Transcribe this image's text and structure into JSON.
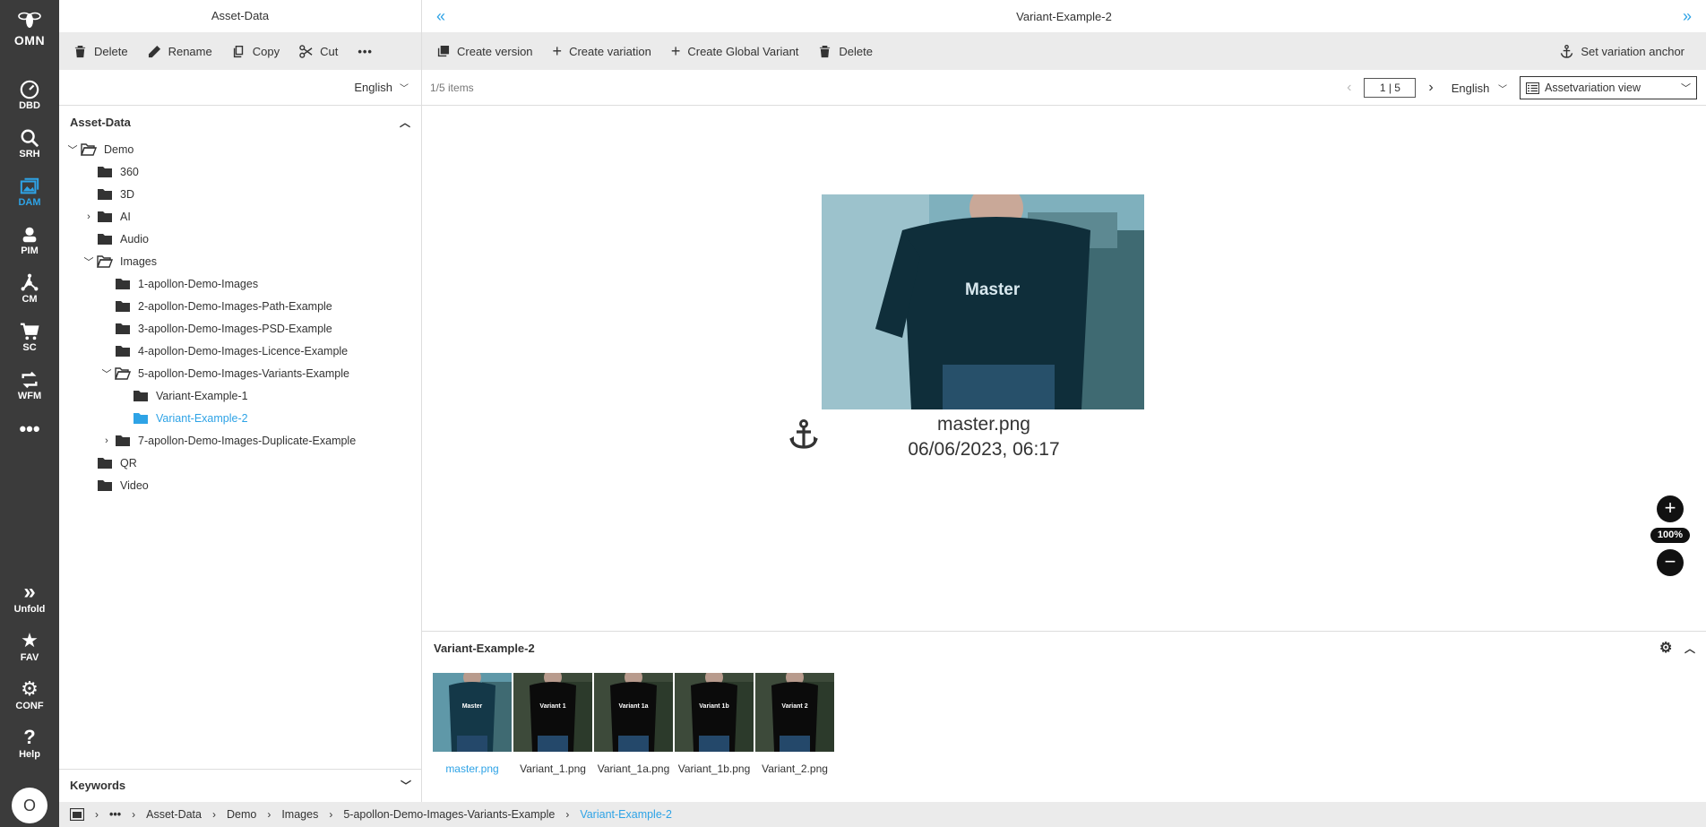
{
  "nav": {
    "logo_text": "OMN",
    "items": [
      {
        "label": "DBD",
        "icon": "dashboard-icon"
      },
      {
        "label": "SRH",
        "icon": "search-icon"
      },
      {
        "label": "DAM",
        "icon": "images-icon"
      },
      {
        "label": "PIM",
        "icon": "product-icon"
      },
      {
        "label": "CM",
        "icon": "network-icon"
      },
      {
        "label": "SC",
        "icon": "cart-icon"
      },
      {
        "label": "WFM",
        "icon": "workflow-icon"
      },
      {
        "label": "",
        "icon": "more-icon"
      }
    ],
    "bottom": [
      {
        "label": "Unfold",
        "icon": "unfold-icon"
      },
      {
        "label": "FAV",
        "icon": "star-icon"
      },
      {
        "label": "CONF",
        "icon": "gear-icon"
      },
      {
        "label": "Help",
        "icon": "help-icon"
      }
    ],
    "avatar": "O",
    "active_color": "#2ea3e6"
  },
  "left": {
    "title": "Asset-Data",
    "toolbar": {
      "delete": "Delete",
      "rename": "Rename",
      "copy": "Copy",
      "cut": "Cut"
    },
    "language": "English",
    "section": "Asset-Data",
    "tree": [
      {
        "label": "Demo",
        "level": 0,
        "expand": "open",
        "folder": "open"
      },
      {
        "label": "360",
        "level": 1,
        "expand": "none",
        "folder": "closed"
      },
      {
        "label": "3D",
        "level": 1,
        "expand": "none",
        "folder": "closed"
      },
      {
        "label": "AI",
        "level": 1,
        "expand": "closed",
        "folder": "closed"
      },
      {
        "label": "Audio",
        "level": 1,
        "expand": "none",
        "folder": "closed"
      },
      {
        "label": "Images",
        "level": 1,
        "expand": "open",
        "folder": "open"
      },
      {
        "label": "1-apollon-Demo-Images",
        "level": 2,
        "expand": "none",
        "folder": "closed"
      },
      {
        "label": "2-apollon-Demo-Images-Path-Example",
        "level": 2,
        "expand": "none",
        "folder": "closed"
      },
      {
        "label": "3-apollon-Demo-Images-PSD-Example",
        "level": 2,
        "expand": "none",
        "folder": "closed"
      },
      {
        "label": "4-apollon-Demo-Images-Licence-Example",
        "level": 2,
        "expand": "none",
        "folder": "closed"
      },
      {
        "label": "5-apollon-Demo-Images-Variants-Example",
        "level": 2,
        "expand": "open",
        "folder": "open"
      },
      {
        "label": "Variant-Example-1",
        "level": 3,
        "expand": "none",
        "folder": "closed"
      },
      {
        "label": "Variant-Example-2",
        "level": 3,
        "expand": "none",
        "folder": "closed",
        "active": true
      },
      {
        "label": "7-apollon-Demo-Images-Duplicate-Example",
        "level": 2,
        "expand": "closed",
        "folder": "closed"
      },
      {
        "label": "QR",
        "level": 1,
        "expand": "none",
        "folder": "closed"
      },
      {
        "label": "Video",
        "level": 1,
        "expand": "none",
        "folder": "closed"
      }
    ],
    "keywords": "Keywords"
  },
  "right": {
    "title": "Variant-Example-2",
    "toolbar": {
      "create_version": "Create version",
      "create_variation": "Create variation",
      "create_global_variant": "Create Global Variant",
      "delete": "Delete",
      "set_anchor": "Set variation anchor"
    },
    "count": "1/5 items",
    "page": "1 | 5",
    "language": "English",
    "view": "Assetvariation view",
    "preview": {
      "overlay_text": "Master",
      "filename": "master.png",
      "date": "06/06/2023, 06:17"
    },
    "zoom": "100%"
  },
  "variants": {
    "title": "Variant-Example-2",
    "items": [
      {
        "caption": "master.png",
        "label": "Master",
        "tint": "#5f98a8",
        "active": true
      },
      {
        "caption": "Variant_1.png",
        "label": "Variant 1",
        "tint": "#3d4a3a"
      },
      {
        "caption": "Variant_1a.png",
        "label": "Variant 1a",
        "tint": "#3d4a3a"
      },
      {
        "caption": "Variant_1b.png",
        "label": "Variant 1b",
        "tint": "#3d4a3a"
      },
      {
        "caption": "Variant_2.png",
        "label": "Variant 2",
        "tint": "#3d4a3a"
      }
    ]
  },
  "breadcrumb": {
    "items": [
      "Asset-Data",
      "Demo",
      "Images",
      "5-apollon-Demo-Images-Variants-Example"
    ],
    "current": "Variant-Example-2"
  }
}
